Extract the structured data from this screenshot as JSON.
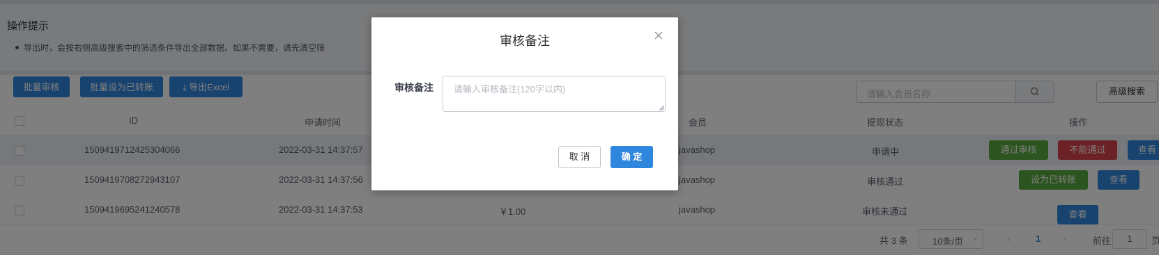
{
  "tips": {
    "title": "操作提示",
    "items": [
      "导出时，会按右侧高级搜索中的筛选条件导出全部数据。如果不需要，请先清空筛"
    ]
  },
  "toolbar": {
    "batch_review": "批量审核",
    "batch_transfer": "批量设为已转账",
    "export_label": "导出Excel",
    "search_placeholder": "请输入会员名称",
    "advanced_search": "高级搜索"
  },
  "table": {
    "headers": {
      "id": "ID",
      "apply_time": "申请时间",
      "member": "会员",
      "status": "提现状态",
      "actions": "操作"
    },
    "rows": [
      {
        "id": "1509419712425304066",
        "time": "2022-03-31 14:37:57",
        "amount": "",
        "member": "javashop",
        "status": "申请中",
        "actions": [
          "通过审核",
          "不能通过",
          "查看"
        ]
      },
      {
        "id": "1509419708272943107",
        "time": "2022-03-31 14:37:56",
        "amount": "",
        "member": "javashop",
        "status": "审核通过",
        "actions": [
          "设为已转账",
          "查看"
        ]
      },
      {
        "id": "1509419695241240578",
        "time": "2022-03-31 14:37:53",
        "amount": "￥1.00",
        "member": "javashop",
        "status": "审核未通过",
        "actions": [
          "查看"
        ]
      }
    ]
  },
  "pagination": {
    "total": "共 3 条",
    "page_size": "10条/页",
    "current_page": "1",
    "goto_label": "前往",
    "goto_value": "1",
    "page_suffix": "页"
  },
  "modal": {
    "title": "审核备注",
    "field_label": "审核备注",
    "placeholder": "请输入审核备注(120字以内)",
    "cancel": "取 消",
    "confirm": "确 定"
  },
  "colors": {
    "primary": "#2f86dd",
    "success": "#58a83d",
    "danger": "#d8434d"
  }
}
